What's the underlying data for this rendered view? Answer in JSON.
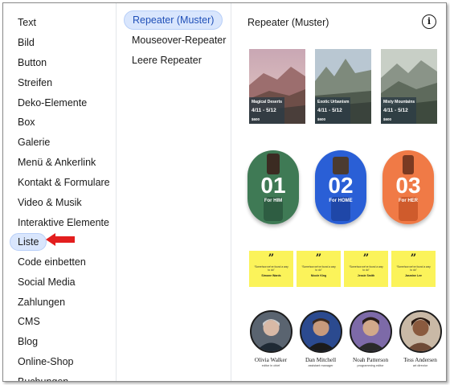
{
  "categories": [
    {
      "label": "Text"
    },
    {
      "label": "Bild"
    },
    {
      "label": "Button"
    },
    {
      "label": "Streifen"
    },
    {
      "label": "Deko-Elemente"
    },
    {
      "label": "Box"
    },
    {
      "label": "Galerie"
    },
    {
      "label": "Menü & Ankerlink"
    },
    {
      "label": "Kontakt & Formulare"
    },
    {
      "label": "Video & Musik"
    },
    {
      "label": "Interaktive Elemente"
    },
    {
      "label": "Liste"
    },
    {
      "label": "Code einbetten"
    },
    {
      "label": "Social Media"
    },
    {
      "label": "Zahlungen"
    },
    {
      "label": "CMS"
    },
    {
      "label": "Blog"
    },
    {
      "label": "Online-Shop"
    },
    {
      "label": "Buchungen"
    }
  ],
  "active_category": "Liste",
  "subcategories": [
    {
      "label": "Repeater (Muster)"
    },
    {
      "label": "Mouseover-Repeater"
    },
    {
      "label": "Leere Repeater"
    }
  ],
  "preview": {
    "title": "Repeater (Muster)",
    "info_symbol": "i",
    "cards": [
      {
        "title": "Magical Deserts",
        "dates": "4/11 - 5/12",
        "price": "$600"
      },
      {
        "title": "Exotic Urbanism",
        "dates": "4/11 - 5/12",
        "price": "$600"
      },
      {
        "title": "Misty Mountains",
        "dates": "4/11 - 5/12",
        "price": "$600"
      }
    ],
    "pills": [
      {
        "num": "01",
        "label": "For HIM",
        "color": "#3f7a55"
      },
      {
        "num": "02",
        "label": "For HOME",
        "color": "#2a5fd6"
      },
      {
        "num": "03",
        "label": "For HER",
        "color": "#f07a46"
      }
    ],
    "quotes": [
      {
        "mark": "”",
        "text": "“Somehow we’ve found a way to do”",
        "name": "Simone Wards"
      },
      {
        "mark": "”",
        "text": "“Somehow we’ve found a way to do”",
        "name": "Nicole King"
      },
      {
        "mark": "”",
        "text": "“Somehow we’ve found a way to do”",
        "name": "Jessie Smith"
      },
      {
        "mark": "”",
        "text": "“Somehow we’ve found a way to do”",
        "name": "Jasmine Lee"
      }
    ],
    "people": [
      {
        "name": "Olivia Walker",
        "role": "editor in chief"
      },
      {
        "name": "Dan Mitchell",
        "role": "assistant manager"
      },
      {
        "name": "Noah Patterson",
        "role": "programming editor"
      },
      {
        "name": "Tess Andersen",
        "role": "art director"
      }
    ]
  },
  "colors": {
    "active_bg": "#d9e6fd",
    "arrow": "#e31e1e",
    "quote_bg": "#fbf35a"
  }
}
